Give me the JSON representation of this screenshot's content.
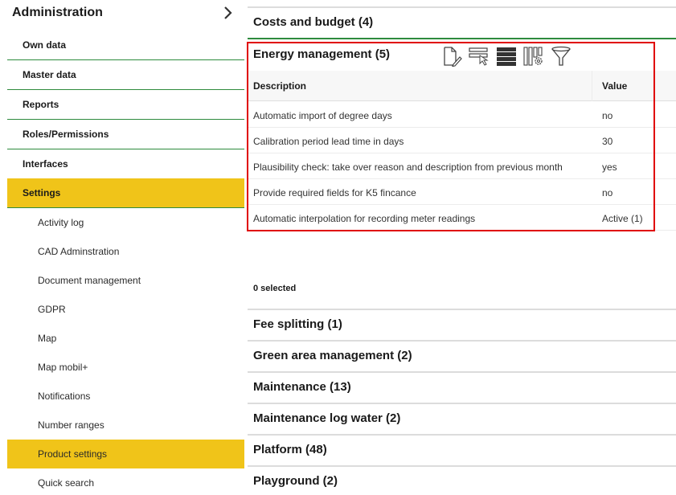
{
  "sidebar": {
    "title": "Administration",
    "items": [
      {
        "label": "Own data"
      },
      {
        "label": "Master data"
      },
      {
        "label": "Reports"
      },
      {
        "label": "Roles/Permissions"
      },
      {
        "label": "Interfaces"
      },
      {
        "label": "Settings",
        "active": true
      }
    ],
    "subitems": [
      {
        "label": "Activity log"
      },
      {
        "label": "CAD Adminstration"
      },
      {
        "label": "Document management"
      },
      {
        "label": "GDPR"
      },
      {
        "label": "Map"
      },
      {
        "label": "Map mobil+"
      },
      {
        "label": "Notifications"
      },
      {
        "label": "Number ranges"
      },
      {
        "label": "Product settings",
        "active": true
      },
      {
        "label": "Quick search"
      }
    ]
  },
  "main": {
    "sections_top": [
      {
        "title": "Costs and budget (4)"
      }
    ],
    "energy": {
      "title": "Energy management (5)",
      "toolbar": [
        {
          "icon": "edit-document-icon"
        },
        {
          "icon": "select-row-icon"
        },
        {
          "icon": "list-density-icon"
        },
        {
          "icon": "column-settings-icon"
        },
        {
          "icon": "filter-icon"
        }
      ],
      "columns": [
        "Description",
        "Value"
      ],
      "rows": [
        {
          "description": "Automatic import of degree days",
          "value": "no"
        },
        {
          "description": "Calibration period lead time in days",
          "value": "30"
        },
        {
          "description": "Plausibility check: take over reason and description from previous month",
          "value": "yes"
        },
        {
          "description": "Provide required fields for K5 fincance",
          "value": "no"
        },
        {
          "description": "Automatic interpolation for recording meter readings",
          "value": "Active (1)"
        }
      ],
      "selected_text": "0 selected"
    },
    "sections_bottom": [
      {
        "title": "Fee splitting (1)"
      },
      {
        "title": "Green area management (2)"
      },
      {
        "title": "Maintenance (13)"
      },
      {
        "title": "Maintenance log water (2)"
      },
      {
        "title": "Platform (48)"
      },
      {
        "title": "Playground (2)"
      }
    ]
  },
  "colors": {
    "accent_yellow": "#f0c419",
    "divider_green": "#2e8b3d",
    "highlight_red": "#e00000"
  }
}
